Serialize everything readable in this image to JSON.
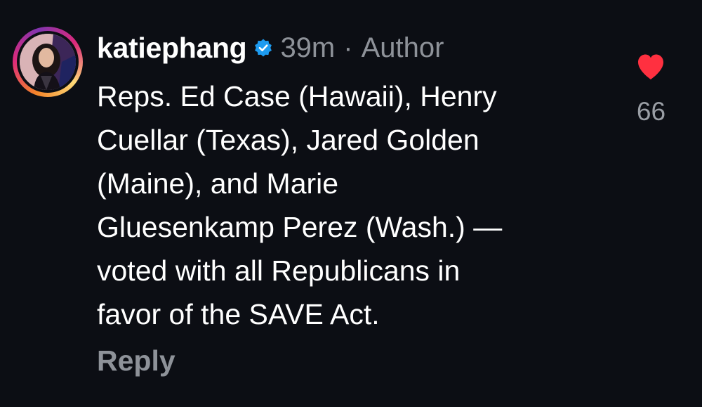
{
  "comment": {
    "username": "katiephang",
    "verified": true,
    "time": "39m",
    "separator": "·",
    "author_label": "Author",
    "text_lines": [
      "Reps. Ed Case (Hawaii), Henry",
      "Cuellar (Texas), Jared Golden",
      "(Maine), and Marie",
      "Gluesenkamp Perez (Wash.) —",
      "voted with all Republicans in",
      "favor of the SAVE Act."
    ],
    "reply_label": "Reply"
  },
  "like": {
    "icon": "heart-icon",
    "liked": true,
    "count": "66"
  },
  "colors": {
    "background": "#0c0e14",
    "text": "#ffffff",
    "muted": "#8e9299",
    "verified": "#1d9bf0",
    "heart": "#ff3040"
  }
}
